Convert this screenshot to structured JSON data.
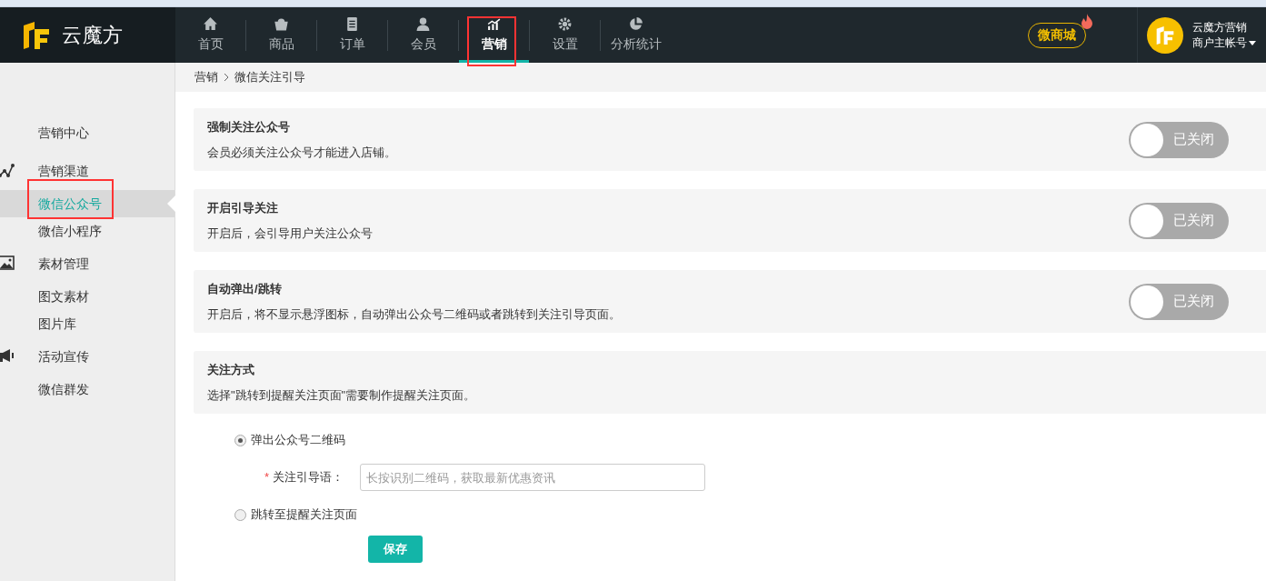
{
  "header": {
    "brand": "云魔方",
    "nav": [
      {
        "label": "首页",
        "selected": false,
        "annotated": false
      },
      {
        "label": "商品",
        "selected": false,
        "annotated": false
      },
      {
        "label": "订单",
        "selected": false,
        "annotated": false
      },
      {
        "label": "会员",
        "selected": false,
        "annotated": false
      },
      {
        "label": "营销",
        "selected": true,
        "annotated": true
      },
      {
        "label": "设置",
        "selected": false,
        "annotated": false
      },
      {
        "label": "分析统计",
        "selected": false,
        "annotated": false
      }
    ],
    "shop_button": "微商城",
    "account": {
      "name": "云魔方营销",
      "role": "商户主帐号"
    }
  },
  "sidebar": {
    "sections": [
      {
        "label": "营销中心"
      },
      {
        "label": "营销渠道",
        "children": [
          {
            "label": "微信公众号",
            "selected": true,
            "annotated": true
          },
          {
            "label": "微信小程序",
            "selected": false,
            "annotated": false
          }
        ]
      },
      {
        "label": "素材管理",
        "children": [
          {
            "label": "图文素材",
            "selected": false,
            "annotated": false
          },
          {
            "label": "图片库",
            "selected": false,
            "annotated": false
          }
        ]
      },
      {
        "label": "活动宣传",
        "children": [
          {
            "label": "微信群发",
            "selected": false,
            "annotated": false
          }
        ]
      }
    ]
  },
  "breadcrumb": [
    "营销",
    "微信关注引导"
  ],
  "settings": [
    {
      "title": "强制关注公众号",
      "description": "会员必须关注公众号才能进入店铺。",
      "on": false,
      "state_label": "已关闭"
    },
    {
      "title": "开启引导关注",
      "description": "开启后，会引导用户关注公众号",
      "on": false,
      "state_label": "已关闭"
    },
    {
      "title": "自动弹出/跳转",
      "description": "开启后，将不显示悬浮图标，自动弹出公众号二维码或者跳转到关注引导页面。",
      "on": false,
      "state_label": "已关闭"
    }
  ],
  "follow_mode": {
    "title": "关注方式",
    "description": "选择\"跳转到提醒关注页面\"需要制作提醒关注页面。",
    "options": [
      {
        "label": "弹出公众号二维码",
        "selected": true
      },
      {
        "label": "跳转至提醒关注页面",
        "selected": false
      }
    ],
    "field": {
      "required_mark": "*",
      "label": "关注引导语：",
      "placeholder": "长按识别二维码，获取最新优惠资讯"
    },
    "save_button": "保存"
  }
}
